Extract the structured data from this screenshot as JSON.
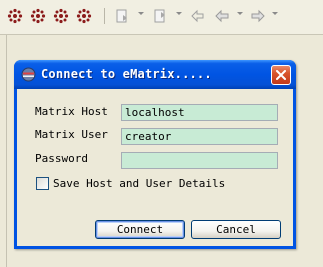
{
  "toolbar": {
    "icons": [
      "debug-launch-icon",
      "run-icon",
      "run-external-icon",
      "external-tools-icon",
      "next-annotation-icon",
      "previous-annotation-icon",
      "back-icon",
      "forward-icon"
    ]
  },
  "dialog": {
    "title": "Connect to eMatrix.....",
    "icon": "connect-app-icon",
    "fields": {
      "host": {
        "label": "Matrix Host",
        "value": "localhost"
      },
      "user": {
        "label": "Matrix User",
        "value": "creator"
      },
      "password": {
        "label": "Password",
        "value": ""
      }
    },
    "save_details": {
      "label": "Save Host and User Details",
      "checked": false
    },
    "buttons": {
      "connect": "Connect",
      "cancel": "Cancel"
    }
  },
  "colors": {
    "titlebar": "#0054e3",
    "input_background": "#c8ebd5",
    "close_button": "#d9542b",
    "dialog_face": "#ece9d8"
  }
}
